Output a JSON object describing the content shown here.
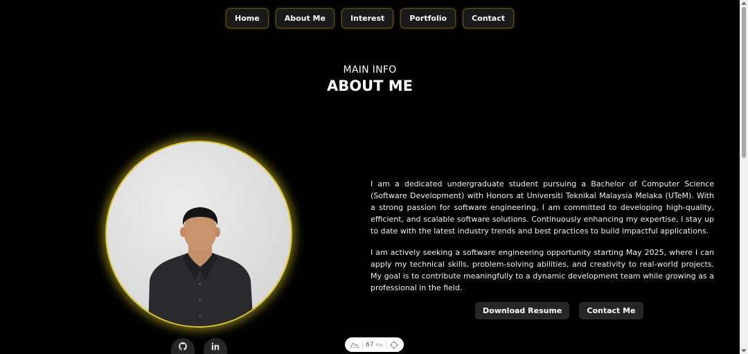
{
  "nav": {
    "items": [
      {
        "label": "Home"
      },
      {
        "label": "About Me"
      },
      {
        "label": "Interest"
      },
      {
        "label": "Portfolio"
      },
      {
        "label": "Contact"
      }
    ]
  },
  "section": {
    "subtitle": "MAIN INFO",
    "title": "ABOUT ME"
  },
  "bio": {
    "paragraph1": "I am a dedicated undergraduate student pursuing a Bachelor of Computer Science (Software Development) with Honors at Universiti Teknikal Malaysia Melaka (UTeM). With a strong passion for software engineering, I am committed to developing high-quality, efficient, and scalable software solutions. Continuously enhancing my expertise, I stay up to date with the latest industry trends and best practices to build impactful applications.",
    "paragraph2": "I am actively seeking a software engineering opportunity starting May 2025, where I can apply my technical skills, problem-solving abilities, and creativity to real-world projects. My goal is to contribute meaningfully to a dynamic development team while growing as a professional in the field."
  },
  "actions": {
    "download_label": "Download Resume",
    "contact_label": "Contact Me"
  },
  "social": {
    "github_icon": "github-icon",
    "linkedin_icon": "linkedin-icon"
  },
  "perf_widget": {
    "value": "67",
    "unit": "ms"
  },
  "colors": {
    "accent": "#d9c22a",
    "background": "#000000",
    "button_bg": "#262626"
  }
}
